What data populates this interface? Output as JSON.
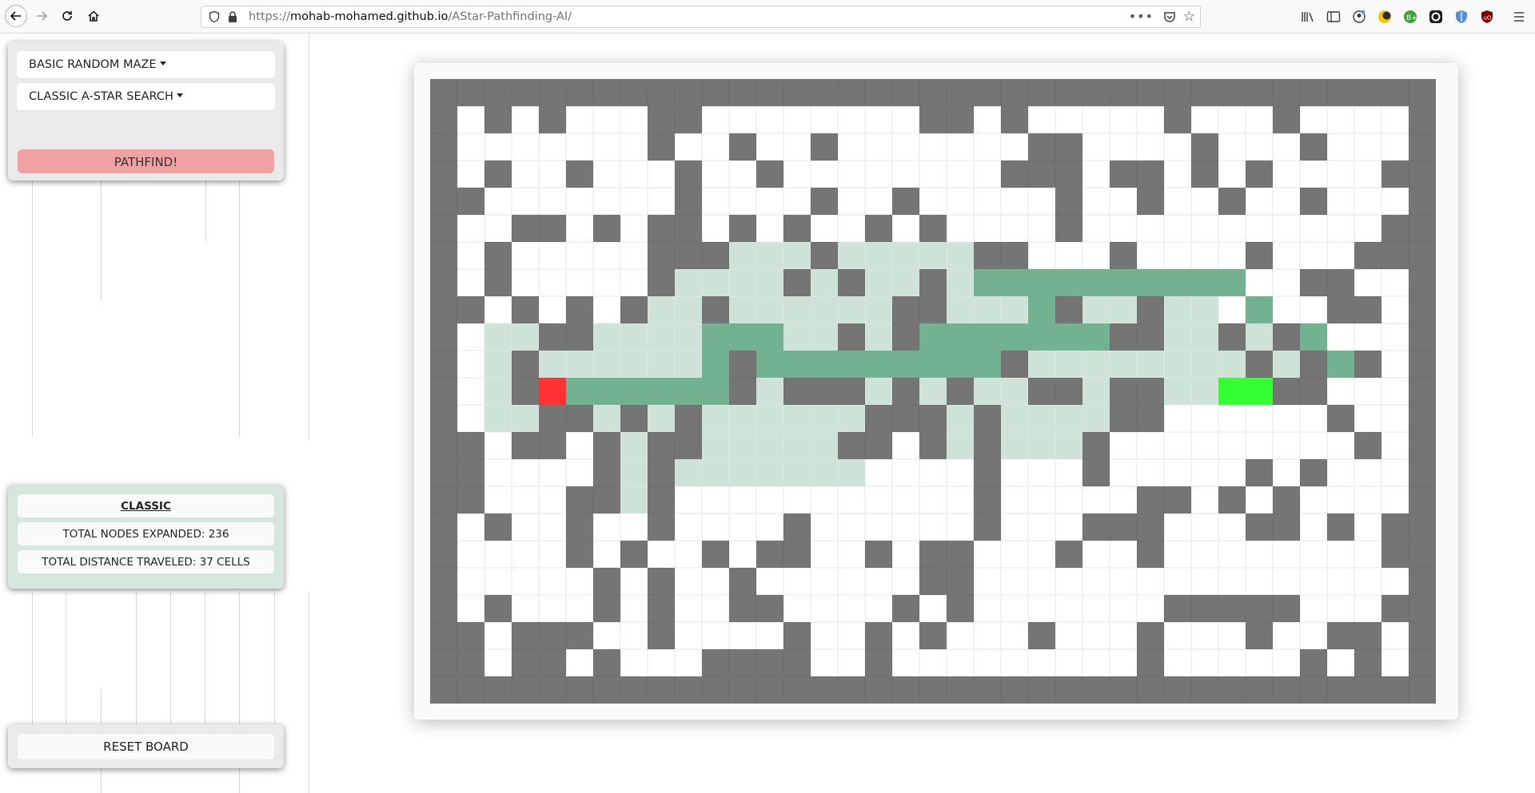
{
  "browser": {
    "url_prefix": "https://",
    "url_host": "mohab-mohamed.github.io",
    "url_path": "/AStar-Pathfinding-AI/"
  },
  "controls": {
    "maze_dropdown": "BASIC RANDOM MAZE",
    "algorithm_dropdown": "CLASSIC A-STAR SEARCH",
    "pathfind_button": "PATHFIND!",
    "reset_button": "RESET BOARD"
  },
  "stats": {
    "title": "CLASSIC",
    "nodes_expanded": "TOTAL NODES EXPANDED: 236",
    "distance": "TOTAL DISTANCE TRAVELED: 37 CELLS"
  },
  "colors": {
    "wall": "#757575",
    "visited": "#cfe2d7",
    "path": "#72b290",
    "start": "#ff3333",
    "goal": "#33ff33",
    "pathfind_button": "#f1a1a2"
  },
  "grid": {
    "legend": {
      "#": "wall",
      ".": "empty",
      "v": "visited",
      "p": "path",
      "S": "start",
      "G": "goal"
    },
    "rows": [
      "#####################################",
      "#.#.#...##........##.#.....#...#....#",
      "#.......#..#..#.......##....#...#...#",
      "#.#..#...#..#........###.##.#.#....##",
      "##.......#....#..#.....#..#..#..#...#",
      "#..##.#.##.#.#..#.#....#...........#",
      "#.#.....###vvv#vvvvv##...#....#...###",
      "#.#.....#vvvv#v#vv#vpppppppppp..##..#",
      "##.#.#.#vv#vvvvvv##vvvp#vv#vv.p..##.#",
      "#.vv##vvvvpppvv#v#ppppppp##vv#v#p...#",
      "#.v#vvvvvvp#ppppppppp#vvvvvvvv#v#p#.#",
      "#.v#Spppppp#v###v#v#vv##v##vvGG##...#",
      "#.vv##v#v#vvvvvv###v#vvvv##......#..#",
      "##.##.#v##vvvvv##.#v#vvv#.........#.#",
      "##....#v#vvvvvvv....#...#.....#.#...#",
      "##...##v#...........#.....##.#.#....#",
      "#.#..#..#....#......#...###...##.#.##",
      "#....#.#..#.##..#.##...#..#........##",
      "#.....#.#..#......##................#",
      "#.#...#.#..##....#.#.......#####...#",
      "##.###..#....#..#.#...#...#...#..##.#",
      "##.##.#...####..#.........#.....#.#.#",
      "#####################################"
    ]
  }
}
